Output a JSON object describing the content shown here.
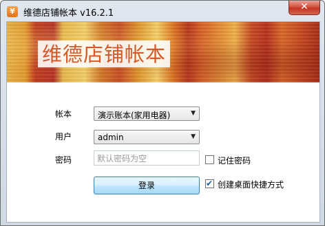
{
  "window": {
    "title": "维德店铺帐本 v16.2.1",
    "app_icon": "¥",
    "close_label": "✕"
  },
  "banner": {
    "title": "维德店铺帐本"
  },
  "form": {
    "account_label": "帐本",
    "account_value": "演示账本(家用电器)",
    "user_label": "用户",
    "user_value": "admin",
    "password_label": "密码",
    "password_placeholder": "默认密码为空",
    "remember_label": "记住密码",
    "remember_checked": false,
    "shortcut_label": "创建桌面快捷方式",
    "shortcut_checked": true,
    "login_label": "登录"
  }
}
